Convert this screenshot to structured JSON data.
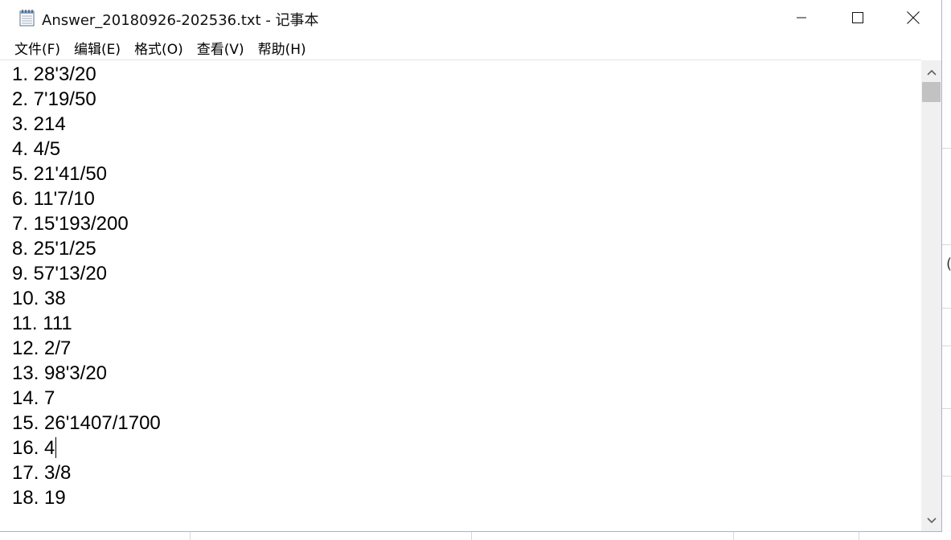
{
  "window": {
    "title": "Answer_20180926-202536.txt - 记事本",
    "icon": "notepad-icon"
  },
  "menu": [
    {
      "label": "文件(F)"
    },
    {
      "label": "编辑(E)"
    },
    {
      "label": "格式(O)"
    },
    {
      "label": "查看(V)"
    },
    {
      "label": "帮助(H)"
    }
  ],
  "document": {
    "lines": [
      "1. 28'3/20",
      "2. 7'19/50",
      "3. 214",
      "4. 4/5",
      "5. 21'41/50",
      "6. 11'7/10",
      "7. 15'193/200",
      "8. 25'1/25",
      "9. 57'13/20",
      "10. 38",
      "11. 111",
      "12. 2/7",
      "13. 98'3/20",
      "14. 7",
      "15. 26'1407/1700",
      "16. 4",
      "17. 3/8",
      "18. 19"
    ],
    "caret_line": 15
  },
  "background_app": {
    "glyph": "("
  }
}
